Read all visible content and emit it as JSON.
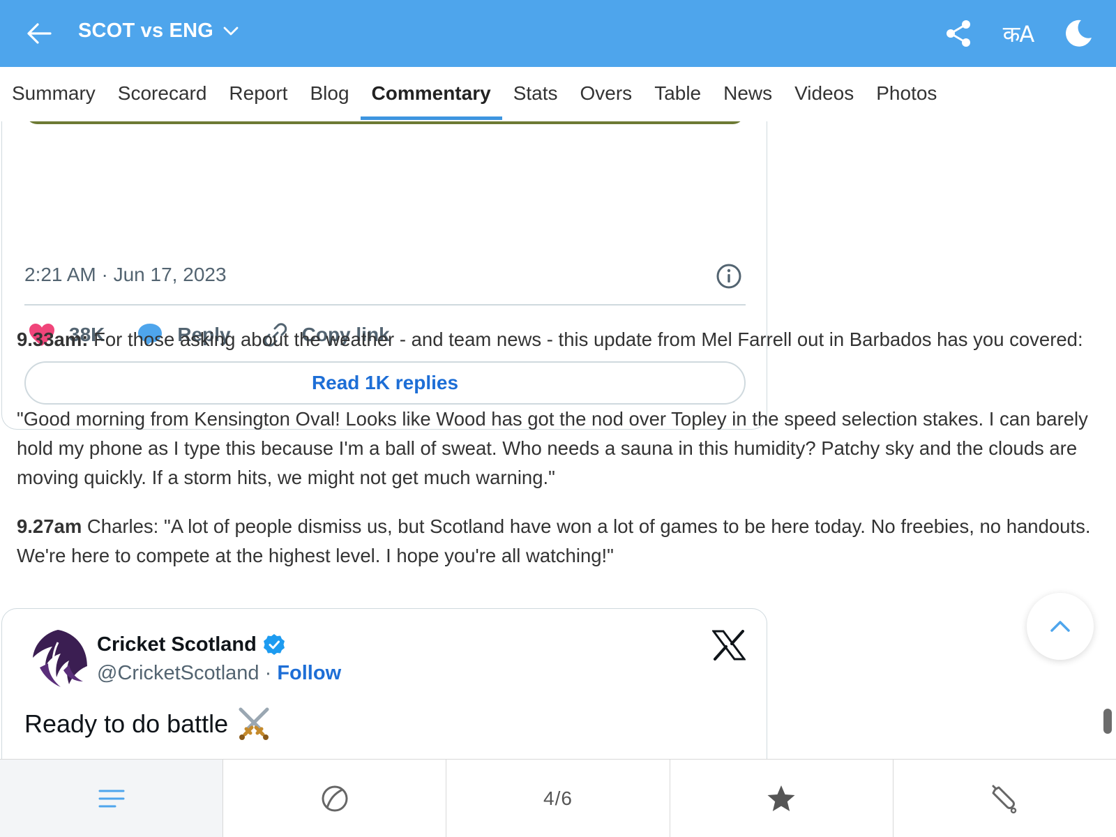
{
  "header": {
    "title": "SCOT vs ENG",
    "lang_label": "कA",
    "icons": [
      "back-arrow-icon",
      "chevron-down-icon",
      "share-icon",
      "language-icon",
      "dark-mode-moon-icon"
    ]
  },
  "tabs": [
    {
      "label": "Summary",
      "active": false
    },
    {
      "label": "Scorecard",
      "active": false
    },
    {
      "label": "Report",
      "active": false
    },
    {
      "label": "Blog",
      "active": false
    },
    {
      "label": "Commentary",
      "active": true
    },
    {
      "label": "Stats",
      "active": false
    },
    {
      "label": "Overs",
      "active": false
    },
    {
      "label": "Table",
      "active": false
    },
    {
      "label": "News",
      "active": false
    },
    {
      "label": "Videos",
      "active": false
    },
    {
      "label": "Photos",
      "active": false
    }
  ],
  "tweet_top": {
    "timestamp": "2:21 AM · Jun 17, 2023",
    "likes": "38K",
    "reply_label": "Reply",
    "copy_link_label": "Copy link",
    "read_replies_label": "Read 1K replies"
  },
  "entries": [
    {
      "time": "9.33am:",
      "text": " For those asking about the weather - and team news - this update from Mel Farrell out in Barbados has you covered:"
    },
    {
      "time": "",
      "text": "\"Good morning from Kensington Oval! Looks like Wood has got the nod over Topley in the speed selection stakes. I can barely hold my phone as I type this because I'm a ball of sweat. Who needs a sauna in this humidity? Patchy sky and the clouds are moving quickly. If a storm hits, we might not get much warning.\""
    },
    {
      "time": "9.27am",
      "text": " Charles: \"A lot of people dismiss us, but Scotland have won a lot of games to be here today. No freebies, no handouts. We're here to compete at the highest level. I hope you're all watching!\""
    }
  ],
  "tweet_bottom": {
    "account_name": "Cricket Scotland",
    "handle": "@CricketScotland",
    "separator": " · ",
    "follow_label": "Follow",
    "body": "Ready to do battle",
    "emoji": "⚔️"
  },
  "bottom_nav": {
    "page_indicator": "4/6",
    "items": [
      "menu-lines-icon",
      "ball-icon",
      "page-indicator",
      "star-icon",
      "cricket-bat-icon"
    ]
  },
  "colors": {
    "header_bg": "#4ea5ec",
    "tab_underline": "#3d95e0",
    "link_blue": "#1d6ed6",
    "like_pink": "#f0457a",
    "reply_blue": "#4ea5ec"
  }
}
